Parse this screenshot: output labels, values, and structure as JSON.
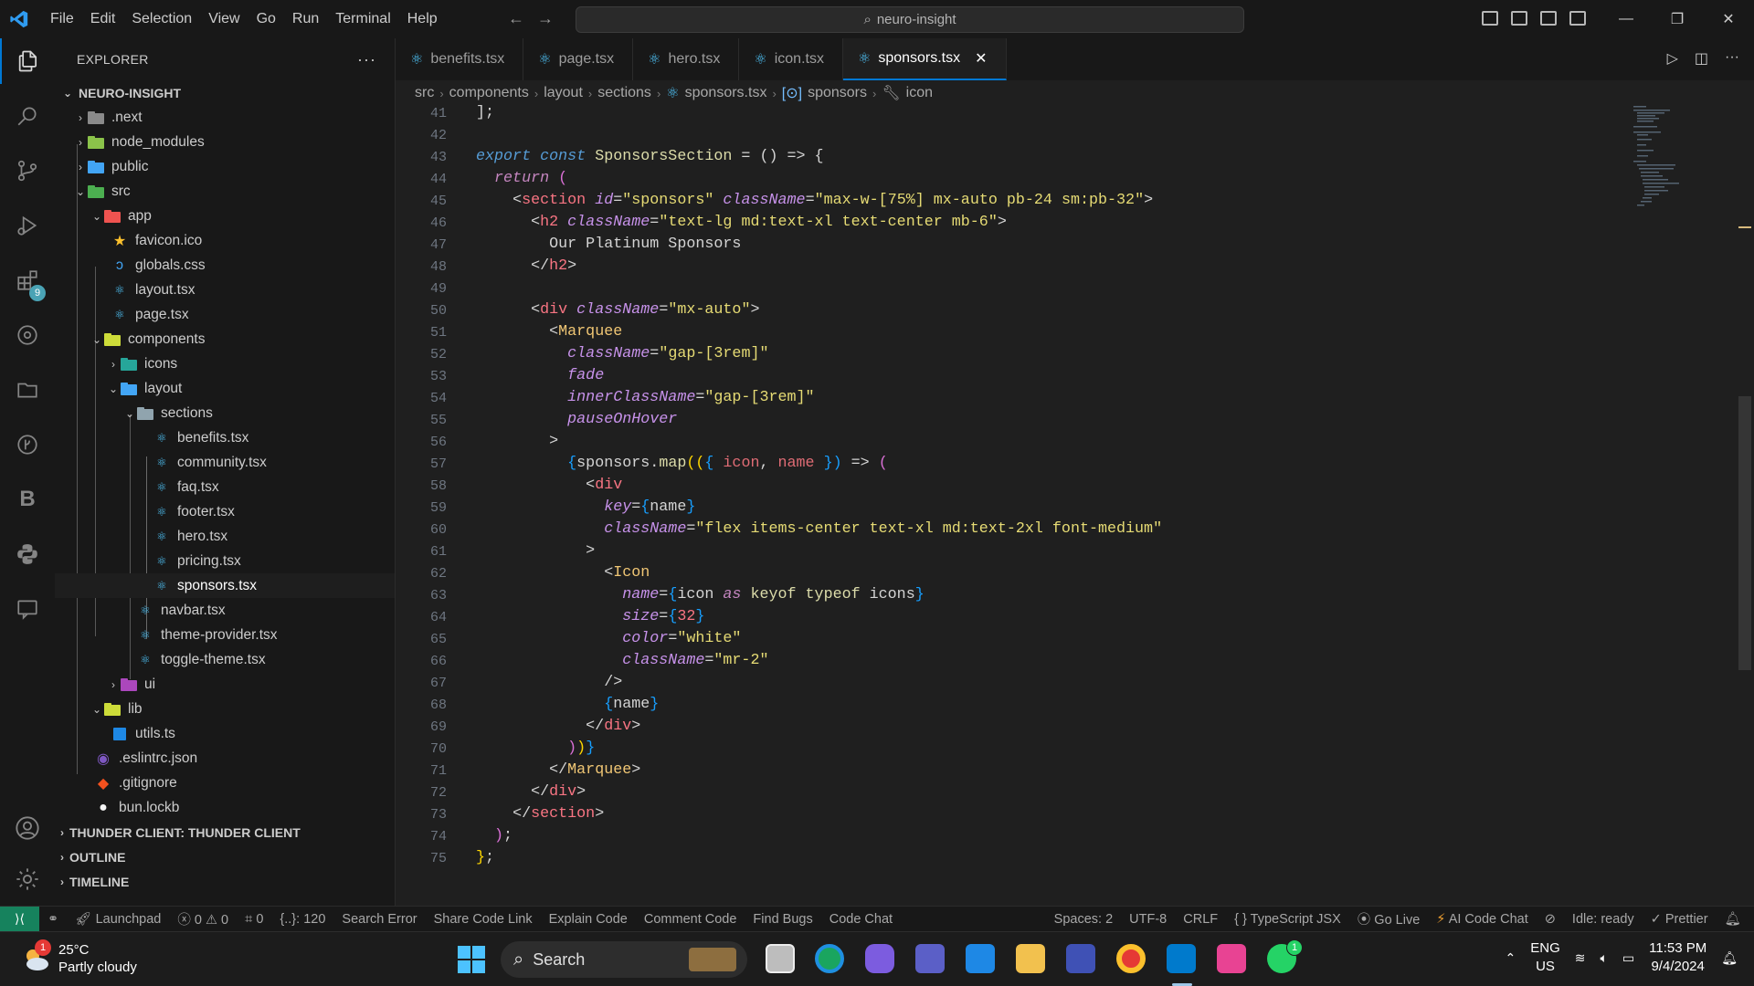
{
  "menu": [
    "File",
    "Edit",
    "Selection",
    "View",
    "Go",
    "Run",
    "Terminal",
    "Help"
  ],
  "command_center": "neuro-insight",
  "explorer": {
    "title": "EXPLORER",
    "project": "NEURO-INSIGHT",
    "tree": [
      {
        "label": ".next"
      },
      {
        "label": "node_modules"
      },
      {
        "label": "public"
      },
      {
        "label": "src"
      },
      {
        "label": "app"
      },
      {
        "label": "favicon.ico"
      },
      {
        "label": "globals.css"
      },
      {
        "label": "layout.tsx"
      },
      {
        "label": "page.tsx"
      },
      {
        "label": "components"
      },
      {
        "label": "icons"
      },
      {
        "label": "layout"
      },
      {
        "label": "sections"
      },
      {
        "label": "benefits.tsx"
      },
      {
        "label": "community.tsx"
      },
      {
        "label": "faq.tsx"
      },
      {
        "label": "footer.tsx"
      },
      {
        "label": "hero.tsx"
      },
      {
        "label": "pricing.tsx"
      },
      {
        "label": "sponsors.tsx"
      },
      {
        "label": "navbar.tsx"
      },
      {
        "label": "theme-provider.tsx"
      },
      {
        "label": "toggle-theme.tsx"
      },
      {
        "label": "ui"
      },
      {
        "label": "lib"
      },
      {
        "label": "utils.ts"
      },
      {
        "label": ".eslintrc.json"
      },
      {
        "label": ".gitignore"
      },
      {
        "label": "bun.lockb"
      }
    ],
    "panels": [
      "THUNDER CLIENT: THUNDER CLIENT",
      "OUTLINE",
      "TIMELINE"
    ]
  },
  "activity_badge": "9",
  "tabs": [
    "benefits.tsx",
    "page.tsx",
    "hero.tsx",
    "icon.tsx",
    "sponsors.tsx"
  ],
  "breadcrumb": [
    "src",
    "components",
    "layout",
    "sections",
    "sponsors.tsx",
    "sponsors",
    "icon"
  ],
  "line_numbers": [
    "41",
    "42",
    "43",
    "44",
    "45",
    "46",
    "47",
    "48",
    "49",
    "50",
    "51",
    "52",
    "53",
    "54",
    "55",
    "56",
    "57",
    "58",
    "59",
    "60",
    "61",
    "62",
    "63",
    "64",
    "65",
    "66",
    "67",
    "68",
    "69",
    "70",
    "71",
    "72",
    "73",
    "74",
    "75"
  ],
  "code": {
    "l41": "];",
    "l43_kw": "export const",
    "l43_name": "SponsorsSection",
    "l43_rest": " = () => {",
    "l44_kw": "return",
    "l44_rest": " (",
    "l45_tag": "section",
    "l45_a1": "id",
    "l45_v1": "\"sponsors\"",
    "l45_a2": "className",
    "l45_v2": "\"max-w-[75%] mx-auto pb-24 sm:pb-32\"",
    "l46_tag": "h2",
    "l46_a1": "className",
    "l46_v1": "\"text-lg md:text-xl text-center mb-6\"",
    "l47": "Our Platinum Sponsors",
    "l48_tag": "h2",
    "l50_tag": "div",
    "l50_a1": "className",
    "l50_v1": "\"mx-auto\"",
    "l51_tag": "Marquee",
    "l52_a": "className",
    "l52_v": "\"gap-[3rem]\"",
    "l53": "fade",
    "l54_a": "innerClassName",
    "l54_v": "\"gap-[3rem]\"",
    "l55": "pauseOnHover",
    "l57_obj": "sponsors",
    "l57_fn": "map",
    "l57_p1": "icon",
    "l57_p2": "name",
    "l58_tag": "div",
    "l59_a": "key",
    "l59_v": "name",
    "l60_a": "className",
    "l60_v": "\"flex items-center text-xl md:text-2xl font-medium\"",
    "l62_tag": "Icon",
    "l63_a": "name",
    "l63_v1": "icon",
    "l63_kw1": "as",
    "l63_kw2": "keyof typeof",
    "l63_v2": "icons",
    "l64_a": "size",
    "l64_v": "32",
    "l65_a": "color",
    "l65_v": "\"white\"",
    "l66_a": "className",
    "l66_v": "\"mr-2\"",
    "l68_v": "name",
    "l69_tag": "div",
    "l71_tag": "Marquee",
    "l72_tag": "div",
    "l73_tag": "section"
  },
  "status": {
    "launchpad": "Launchpad",
    "problems": "0",
    "warnings": "0",
    "ports": "0",
    "position": "{..}: 120",
    "search_error": "Search Error",
    "share": "Share Code Link",
    "explain": "Explain Code",
    "comment": "Comment Code",
    "bugs": "Find Bugs",
    "chat": "Code Chat",
    "spaces": "Spaces: 2",
    "encoding": "UTF-8",
    "eol": "CRLF",
    "language": "TypeScript JSX",
    "golive": "Go Live",
    "ai_chat": "AI Code Chat",
    "idle": "Idle: ready",
    "prettier": "Prettier"
  },
  "taskbar": {
    "temp": "25°C",
    "weather": "Partly cloudy",
    "weather_badge": "1",
    "search": "Search",
    "lang1": "ENG",
    "lang2": "US",
    "time": "11:53 PM",
    "date": "9/4/2024",
    "whatsapp_badge": "1"
  }
}
